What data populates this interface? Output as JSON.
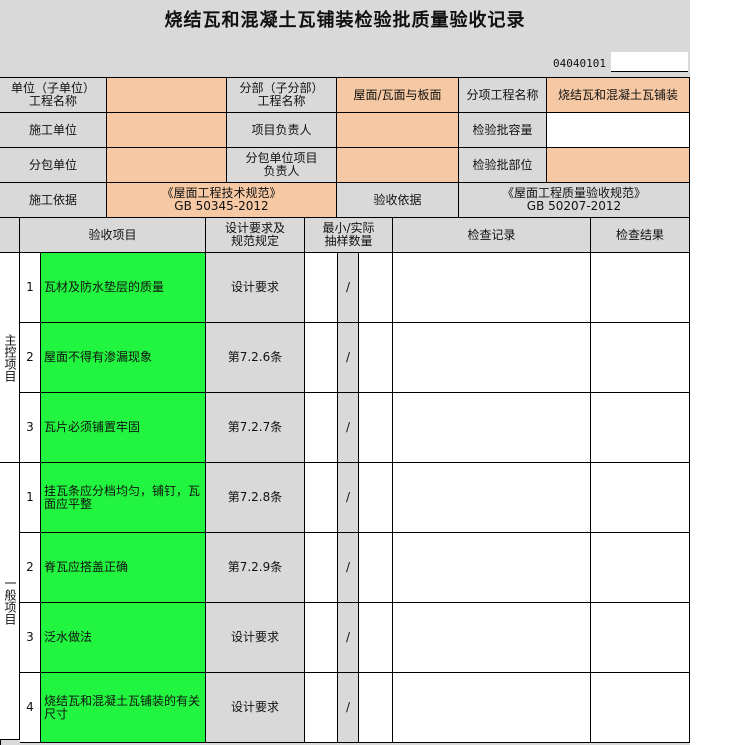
{
  "title": "烧结瓦和混凝土瓦铺装检验批质量验收记录",
  "doc_no": "04040101",
  "header": {
    "r1": [
      "单位（子单位）\n工程名称",
      "",
      "分部（子分部）\n工程名称",
      "屋面/瓦面与板面",
      "分项工程名称",
      "烧结瓦和混凝土瓦铺装"
    ],
    "r2": [
      "施工单位",
      "",
      "项目负责人",
      "",
      "检验批容量",
      ""
    ],
    "r3": [
      "分包单位",
      "",
      "分包单位项目\n负责人",
      "",
      "检验批部位",
      ""
    ],
    "r4": [
      "施工依据",
      "《屋面工程技术规范》\nGB 50345-2012",
      "验收依据",
      "《屋面工程质量验收规范》\nGB 50207-2012"
    ]
  },
  "table_header": {
    "item": "验收项目",
    "design": "设计要求及\n规范规定",
    "sample": "最小/实际\n抽样数量",
    "record": "检查记录",
    "result": "检查结果"
  },
  "groups": {
    "main": "主控项目",
    "general": "一般项目"
  },
  "rows": [
    {
      "no": "1",
      "item": "瓦材及防水垫层的质量",
      "design": "设计要求",
      "sample": "/"
    },
    {
      "no": "2",
      "item": "屋面不得有渗漏现象",
      "design": "第7.2.6条",
      "sample": "/"
    },
    {
      "no": "3",
      "item": "瓦片必须铺置牢固",
      "design": "第7.2.7条",
      "sample": "/"
    },
    {
      "no": "1",
      "item": "挂瓦条应分档均匀，铺钉，瓦面应平整",
      "design": "第7.2.8条",
      "sample": "/"
    },
    {
      "no": "2",
      "item": "脊瓦应搭盖正确",
      "design": "第7.2.9条",
      "sample": "/"
    },
    {
      "no": "3",
      "item": "泛水做法",
      "design": "设计要求",
      "sample": "/"
    },
    {
      "no": "4",
      "item": "烧结瓦和混凝土瓦铺装的有关尺寸",
      "design": "设计要求",
      "sample": "/"
    }
  ],
  "colors": {
    "peach": "#f6c9a4",
    "green": "#22f53f",
    "grey": "#d9d9d9"
  }
}
